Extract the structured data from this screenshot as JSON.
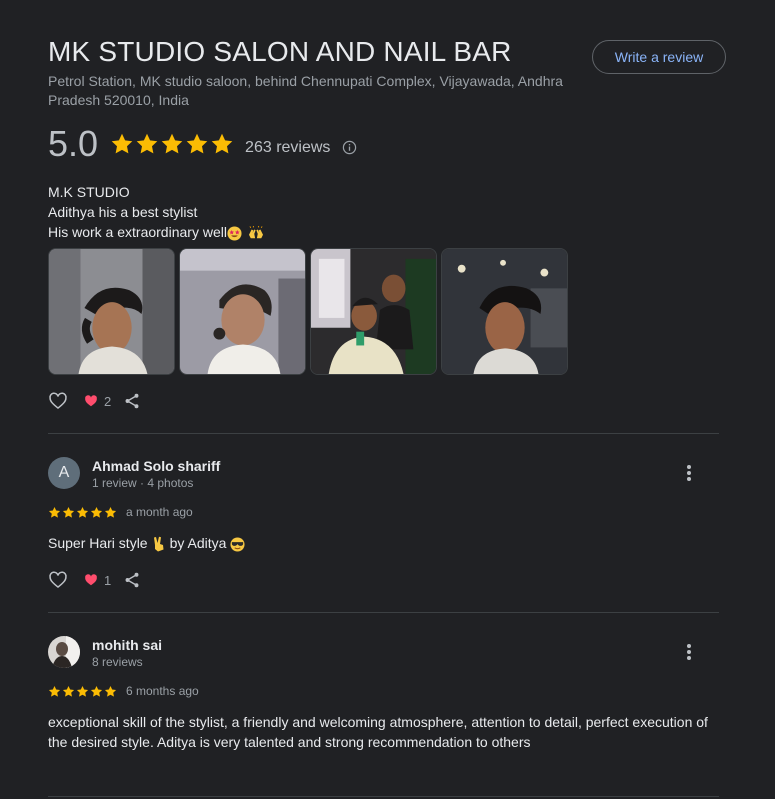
{
  "place": {
    "title": "MK STUDIO SALON AND NAIL BAR",
    "address": "Petrol Station, MK studio saloon, behind Chennupati Complex, Vijayawada, Andhra Pradesh 520010, India",
    "write_review_label": "Write a review",
    "rating": "5.0",
    "stars": 5,
    "review_count": "263 reviews",
    "icons": {
      "info": "info-icon",
      "star": "star-icon"
    },
    "colors": {
      "star": "#fbbc04",
      "link": "#8ab4f8",
      "heart": "#ff4d6d"
    }
  },
  "first_review": {
    "lines": [
      "M.K STUDIO",
      "Adithya his a best stylist",
      "His work a extraordinary well"
    ],
    "emojis": [
      "star-struck-emoji",
      "raising-hands-emoji"
    ],
    "photos": [
      "photo-haircut-side",
      "photo-haircut-back",
      "photo-customer-selfie",
      "photo-haircut-profile"
    ],
    "reaction_count": "2"
  },
  "reviews": [
    {
      "name": "Ahmad Solo shariff",
      "avatar_letter": "A",
      "sub": "1 review · 4 photos",
      "stars": 5,
      "date": "a month ago",
      "text_parts": [
        "Super Hari style",
        "by Aditya"
      ],
      "emojis": [
        "victory-hand-emoji",
        "smiling-face-with-sunglasses-emoji"
      ],
      "reaction_count": "1"
    },
    {
      "name": "mohith sai",
      "sub": "8 reviews",
      "stars": 5,
      "date": "6 months ago",
      "text": "exceptional skill of the stylist, a friendly and welcoming atmosphere, attention to detail, perfect execution of the desired style. Aditya is very talented and strong recommendation to others"
    }
  ]
}
